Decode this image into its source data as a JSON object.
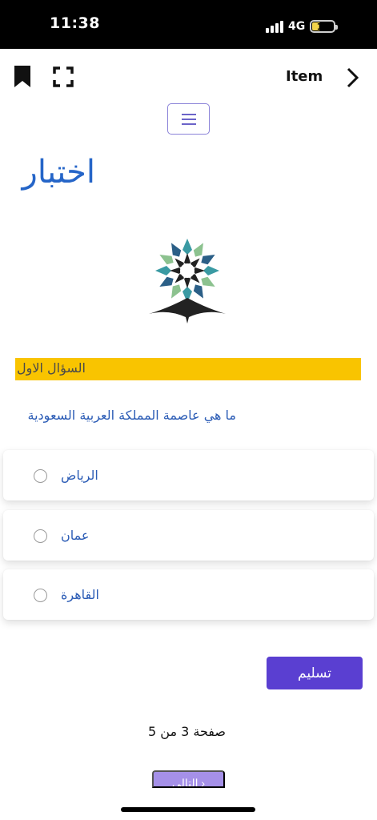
{
  "status_bar": {
    "time": "11:38",
    "network": "4G",
    "battery": "17",
    "battery_level": 0.17
  },
  "toolbar": {
    "bookmark_icon": "bookmark-icon",
    "fullscreen_icon": "fullscreen-icon",
    "item_label": "Item",
    "forward_icon": "chevron-right-icon"
  },
  "page": {
    "menu_icon": "hamburger-icon",
    "title": "اختبار"
  },
  "question": {
    "header": "السؤال الاول",
    "text": "ما هي عاصمة المملكة العربية السعودية",
    "options": [
      {
        "label": "الرياض",
        "selected": false
      },
      {
        "label": "عمان",
        "selected": false
      },
      {
        "label": "القاهرة",
        "selected": false
      }
    ]
  },
  "actions": {
    "submit_label": "تسليم",
    "page_indicator": "صفحة 3 من 5",
    "next_label": "التالي ›"
  },
  "colors": {
    "accent": "#5a3fd1",
    "title": "#2565c8",
    "question_header_bg": "#f9c400",
    "option_text": "#2a5bb5",
    "next_button": "#a590e8"
  }
}
